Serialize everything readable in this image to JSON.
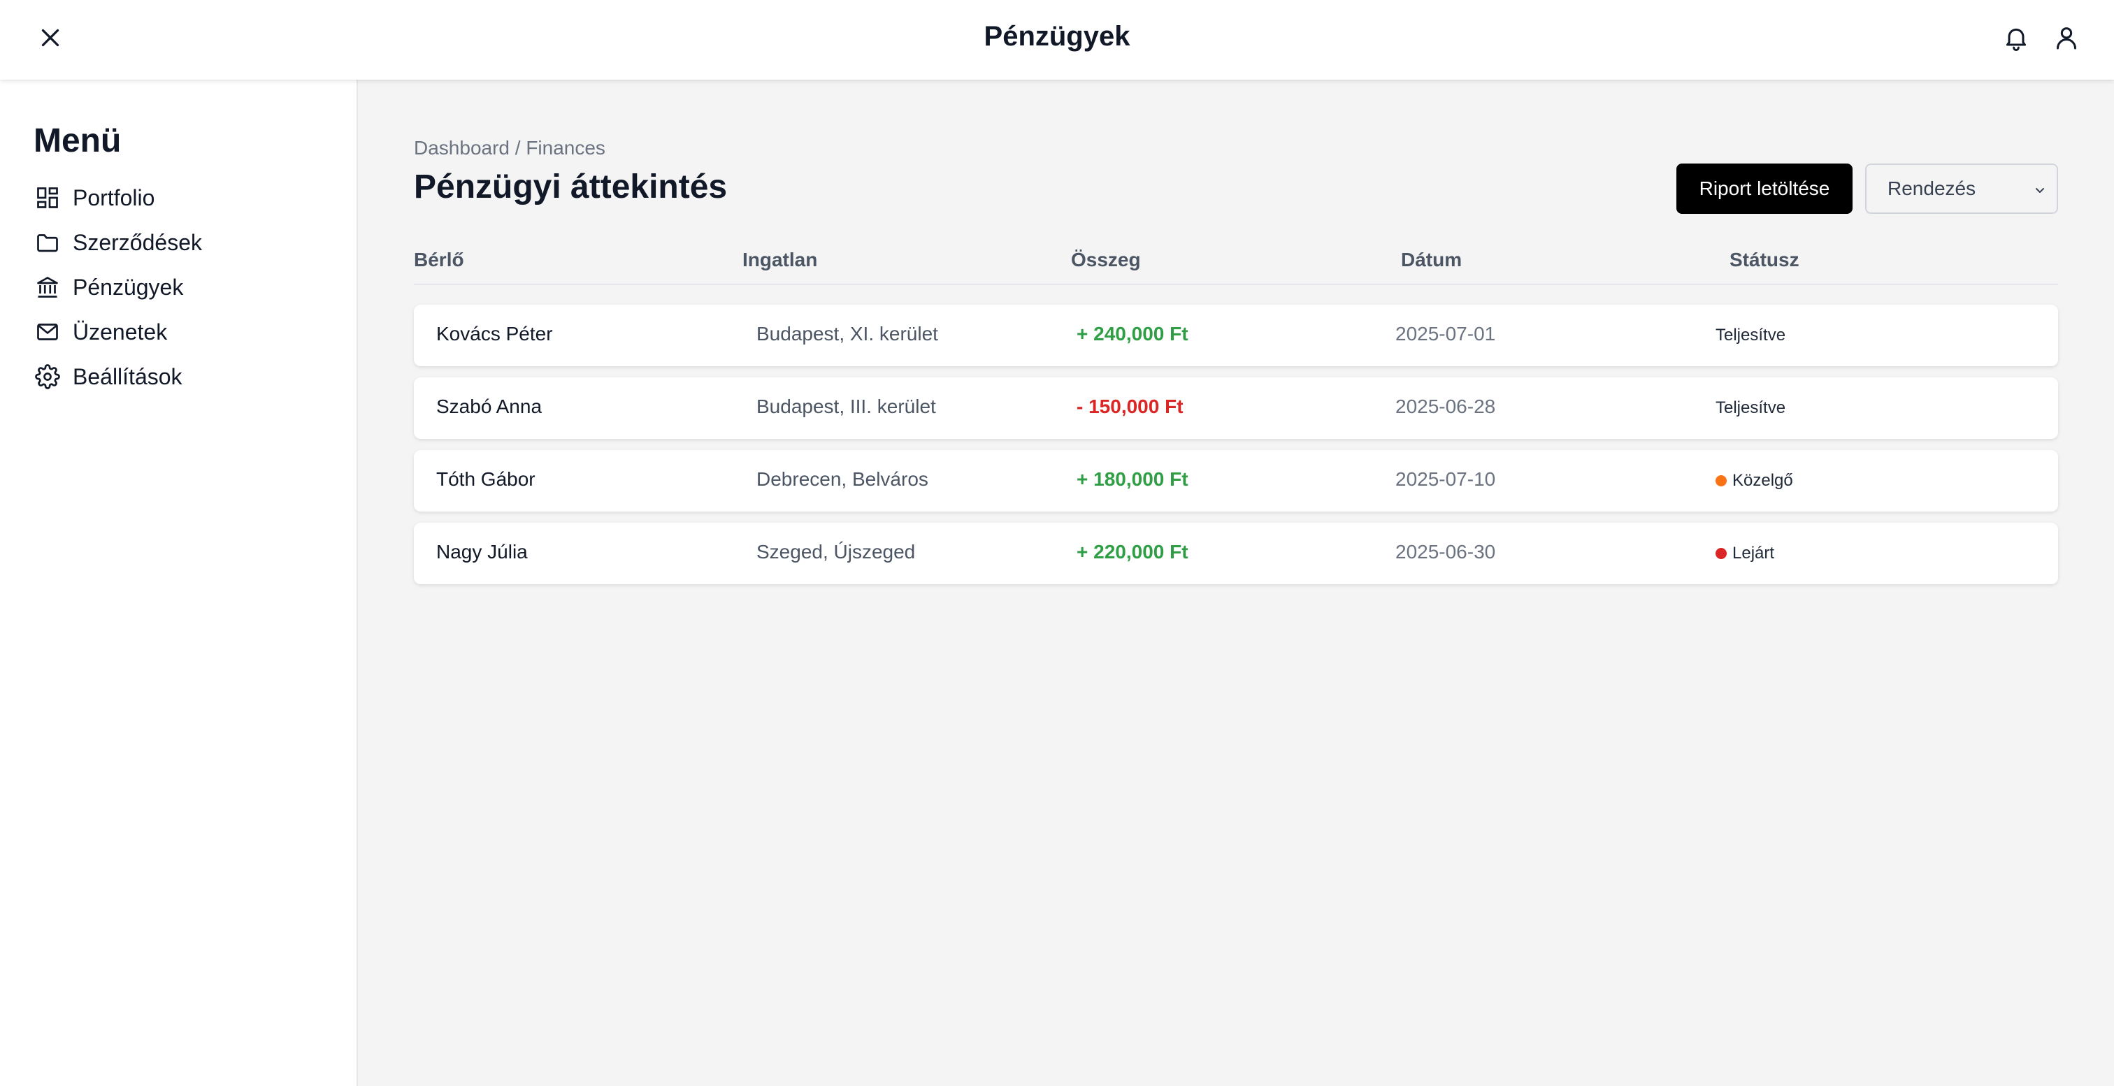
{
  "header": {
    "title": "Pénzügyek"
  },
  "sidebar": {
    "title": "Menü",
    "items": [
      {
        "label": "Portfolio",
        "icon": "dashboard-icon"
      },
      {
        "label": "Szerződések",
        "icon": "folder-icon"
      },
      {
        "label": "Pénzügyek",
        "icon": "bank-icon"
      },
      {
        "label": "Üzenetek",
        "icon": "mail-icon"
      },
      {
        "label": "Beállítások",
        "icon": "gear-icon"
      }
    ]
  },
  "main": {
    "breadcrumb": "Dashboard / Finances",
    "title": "Pénzügyi áttekintés",
    "report_button": "Riport letöltése",
    "sort_label": "Rendezés",
    "columns": [
      "Bérlő",
      "Ingatlan",
      "Összeg",
      "Dátum",
      "Státusz"
    ],
    "rows": [
      {
        "tenant": "Kovács Péter",
        "property": "Budapest, XI. kerület",
        "amount": "+ 240,000 Ft",
        "date": "2025-07-01",
        "status": "Teljesítve"
      },
      {
        "tenant": "Szabó Anna",
        "property": "Budapest, III. kerület",
        "amount": "- 150,000 Ft",
        "date": "2025-06-28",
        "status": "Teljesítve"
      },
      {
        "tenant": "Tóth Gábor",
        "property": "Debrecen, Belváros",
        "amount": "+ 180,000 Ft",
        "date": "2025-07-10",
        "status": "Közelgő"
      },
      {
        "tenant": "Nagy Júlia",
        "property": "Szeged, Újszeged",
        "amount": "+ 220,000 Ft",
        "date": "2025-06-30",
        "status": "Lejárt"
      }
    ]
  },
  "colors": {
    "positive": "#2f9e44",
    "negative": "#dc2626",
    "status_upcoming": "#f97316",
    "status_overdue": "#dc2626",
    "button_bg": "#000000"
  }
}
